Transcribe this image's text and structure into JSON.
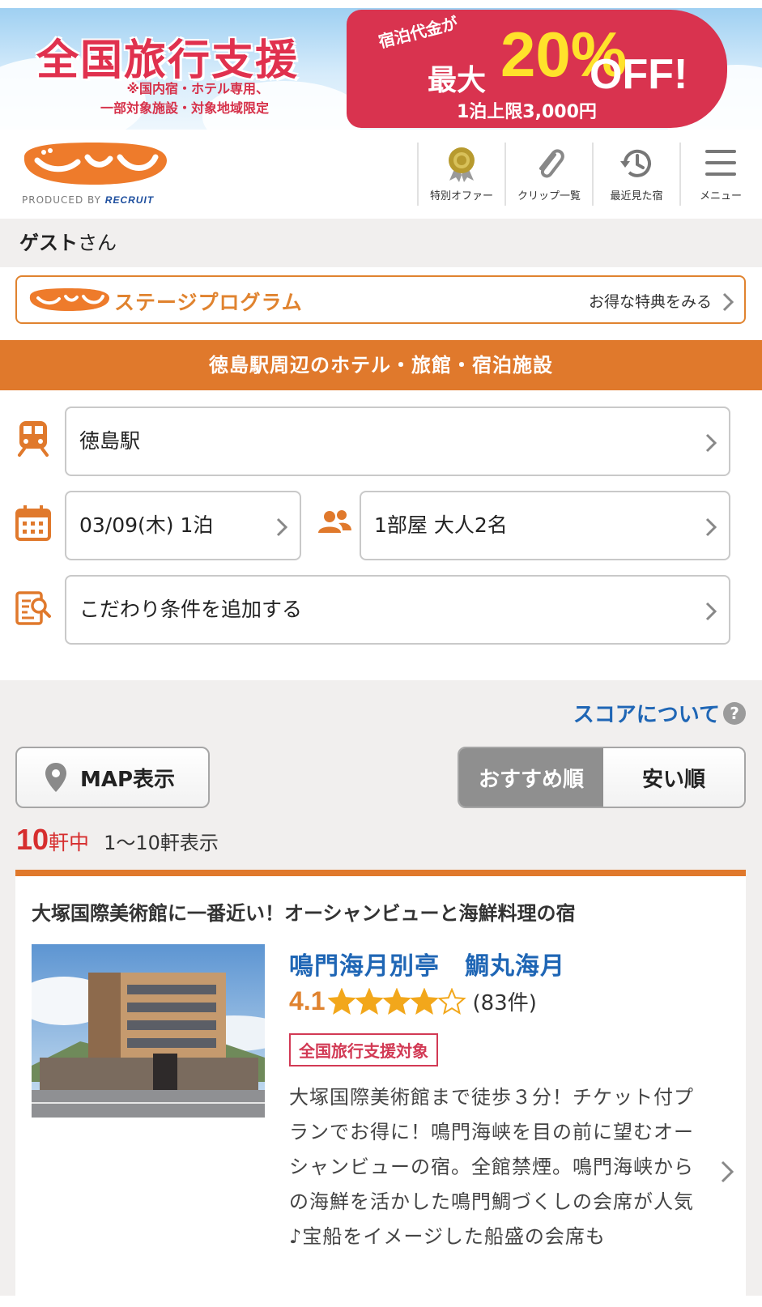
{
  "banner": {
    "title": "全国旅行支援",
    "note_line1": "※国内宿・ホテル専用、",
    "note_line2": "一部対象施設・対象地域限定",
    "pre": "宿泊代金が",
    "max": "最大",
    "pct": "20%",
    "off": "OFF!",
    "limit": "1泊上限3,000円"
  },
  "header": {
    "produced": "PRODUCED BY",
    "recruit": "RECRUIT",
    "nav": [
      {
        "label": "特別オファー",
        "icon": "medal-icon"
      },
      {
        "label": "クリップ一覧",
        "icon": "paperclip-icon"
      },
      {
        "label": "最近見た宿",
        "icon": "history-clock-icon"
      },
      {
        "label": "メニュー",
        "icon": "hamburger-menu-icon"
      }
    ]
  },
  "guest": {
    "name": "ゲスト",
    "suffix": "さん"
  },
  "stage": {
    "title": "ステージプログラム",
    "link": "お得な特典をみる"
  },
  "band": {
    "title": "徳島駅周辺のホテル・旅館・宿泊施設"
  },
  "search": {
    "station": "徳島駅",
    "date": "03/09(木) 1泊",
    "guests": "1部屋 大人2名",
    "conditions": "こだわり条件を追加する"
  },
  "results": {
    "score_link": "スコアについて",
    "map_button": "MAP表示",
    "sort_recommended": "おすすめ順",
    "sort_cheap": "安い順",
    "count_num": "10",
    "count_unit": "軒中",
    "count_range": "1〜10軒表示"
  },
  "hotel": {
    "catch": "大塚国際美術館に一番近い！オーシャンビューと海鮮料理の宿",
    "name": "鳴門海月別亭　鯛丸海月",
    "rating": "4.1",
    "stars": 4.1,
    "reviews": "(83件)",
    "badge": "全国旅行支援対象",
    "desc": "大塚国際美術館まで徒歩３分！チケット付プランでお得に！鳴門海峡を目の前に望むオーシャンビューの宿。全館禁煙。鳴門海峡からの海鮮を活かした鳴門鯛づくしの会席が人気♪宝船をイメージした船盛の会席も"
  },
  "colors": {
    "brand_orange": "#e0792c",
    "link_blue": "#1f66b5",
    "badge_red": "#d23a55"
  }
}
